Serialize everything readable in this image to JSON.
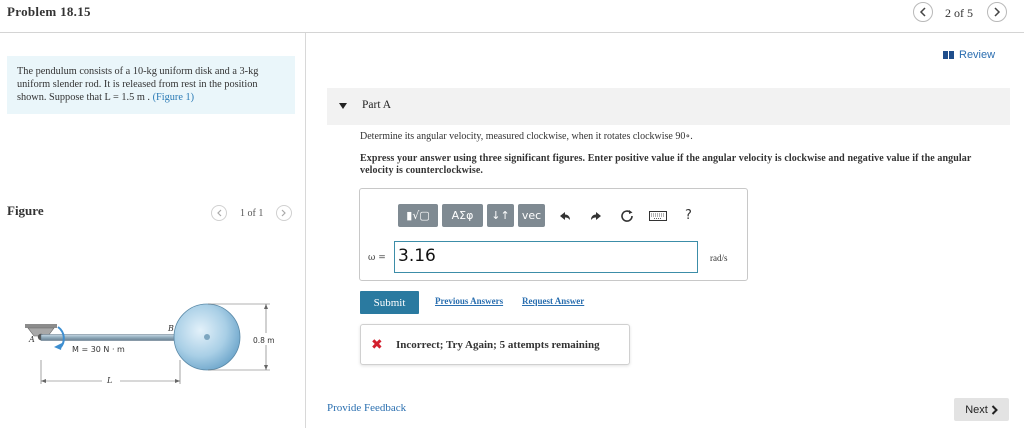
{
  "header": {
    "problem_title": "Problem 18.15",
    "pager": "2 of 5"
  },
  "intro": {
    "text": "The pendulum consists of a 10-kg uniform disk and a 3-kg uniform slender rod. It is released from rest in the position shown. Suppose that L = 1.5 m .",
    "figure_link": "(Figure 1)"
  },
  "figure": {
    "label": "Figure",
    "pager": "1 of 1",
    "labels": {
      "point_a": "A",
      "point_b": "B",
      "moment": "M = 30 N · m",
      "length": "L",
      "diameter": "0.8 m"
    }
  },
  "review": {
    "label": "Review"
  },
  "part": {
    "title": "Part A",
    "question": "Determine its angular velocity, measured clockwise, when it rotates clockwise 90∘.",
    "instructions": "Express your answer using three significant figures. Enter positive value if the angular velocity is clockwise and negative value if the angular velocity is counterclockwise."
  },
  "toolbar": {
    "template_label": "▮√▢",
    "greek_label": "ΑΣφ",
    "arrows_label": "↓↑",
    "vec_label": "vec",
    "undo_icon": "undo-icon",
    "redo_icon": "redo-icon",
    "reset_icon": "reset-icon",
    "keyboard_icon": "keyboard-icon",
    "help_label": "?"
  },
  "answer": {
    "variable": "ω =",
    "value": "3.16",
    "unit": "rad/s"
  },
  "actions": {
    "submit": "Submit",
    "previous_answers": "Previous Answers",
    "request_answer": "Request Answer"
  },
  "feedback": {
    "message": "Incorrect; Try Again; 5 attempts remaining",
    "status_color": "#d3202e"
  },
  "footer": {
    "provide_feedback": "Provide Feedback",
    "next": "Next"
  },
  "colors": {
    "accent": "#2a7aa0",
    "link": "#2a6fb0",
    "intro_bg": "#eaf6fa"
  }
}
